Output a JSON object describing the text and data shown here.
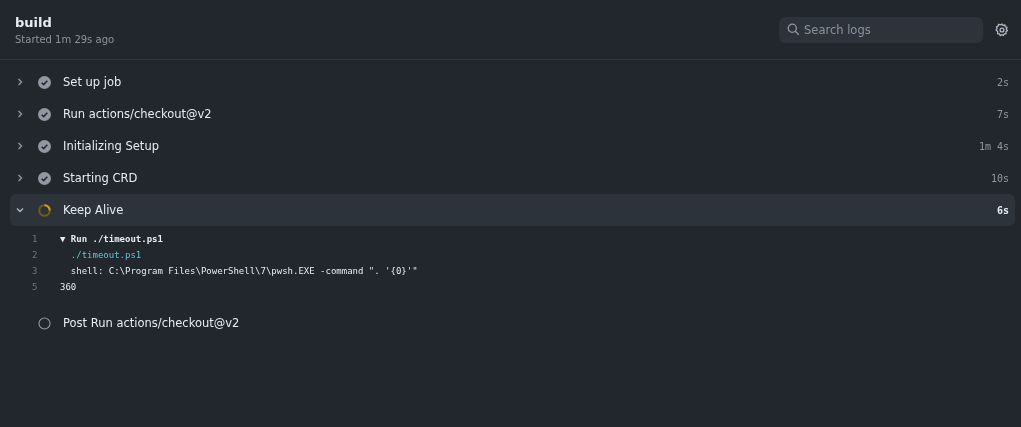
{
  "job": {
    "title": "build",
    "subtitle": "Started 1m 29s ago"
  },
  "search": {
    "placeholder": "Search logs"
  },
  "steps": [
    {
      "name": "Set up job",
      "kind": "success",
      "expanded": false,
      "duration": "2s"
    },
    {
      "name": "Run actions/checkout@v2",
      "kind": "success",
      "expanded": false,
      "duration": "7s"
    },
    {
      "name": "Initializing Setup",
      "kind": "success",
      "expanded": false,
      "duration": "1m 4s"
    },
    {
      "name": "Starting CRD",
      "kind": "success",
      "expanded": false,
      "duration": "10s"
    },
    {
      "name": "Keep Alive",
      "kind": "running",
      "expanded": true,
      "duration": "6s",
      "log": [
        {
          "number": "1",
          "text": "▼ Run ./timeout.ps1",
          "kind": "group"
        },
        {
          "number": "2",
          "text": "  ./timeout.ps1",
          "kind": "command"
        },
        {
          "number": "3",
          "text": "  shell: C:\\Program Files\\PowerShell\\7\\pwsh.EXE -command \". '{0}'\"",
          "kind": "plain"
        },
        {
          "number": "5",
          "text": "360",
          "kind": "plain"
        }
      ]
    },
    {
      "name": "Post Run actions/checkout@v2",
      "kind": "pending",
      "expanded": false
    }
  ]
}
